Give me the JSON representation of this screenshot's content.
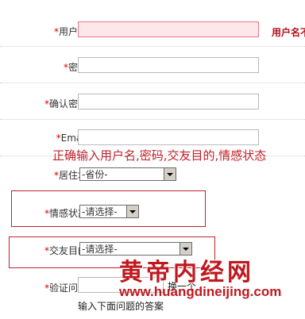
{
  "form": {
    "username": {
      "required_mark": "*",
      "label": "用户名:",
      "value": "",
      "side_text": "用户名不"
    },
    "password": {
      "required_mark": "*",
      "label": "密码:",
      "value": ""
    },
    "confirm_password": {
      "required_mark": "*",
      "label": "确认密码:",
      "value": ""
    },
    "email": {
      "required_mark": "*",
      "label": "Email:",
      "value": ""
    },
    "residence": {
      "required_mark": "*",
      "label": "居住地:",
      "selected": "-省份-"
    },
    "emotional_status": {
      "required_mark": "*",
      "label": "情感状态:",
      "selected": "-请选择-"
    },
    "dating_purpose": {
      "required_mark": "*",
      "label": "交友目的:",
      "selected": "-请选择-"
    },
    "verify_question": {
      "required_mark": "*",
      "label": "验证问答:",
      "value": "",
      "swap_link": "换一个",
      "hint": "输入下面问题的答案"
    }
  },
  "annotation": {
    "text": "正确输入用户名,密码,交友目的,情感状态",
    "color": "#c0232c"
  },
  "watermark": {
    "cn": "黄帝内经网",
    "url": "www.huangdineijing.com",
    "color": "#c0181f"
  }
}
